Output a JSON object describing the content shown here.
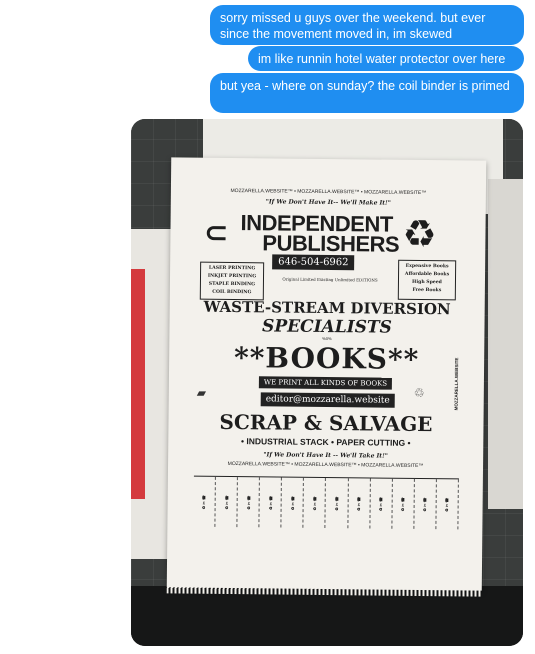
{
  "messages": [
    {
      "text": "sorry missed u guys over the weekend. but ever since the movement moved in, im skewed"
    },
    {
      "text": "im like runnin hotel water protector over here"
    },
    {
      "text": "but yea - where on sunday? the coil binder is primed"
    }
  ],
  "colors": {
    "bubble": "#1f8ef1",
    "bubble_text": "#ffffff"
  },
  "poster": {
    "top_row": "MOZZARELLA.WEBSITE™ • MOZZARELLA.WEBSITE™ • MOZZARELLA.WEBSITE™",
    "motto": "\"If We Don't Have It-- We'll Make It!\"",
    "title_line1": "INDEPENDENT",
    "title_line2": "PUBLISHERS",
    "phone": "646-504-6962",
    "left_box": [
      "LASER PRINTING",
      "INKJET PRINTING",
      "STAPLE BINDING",
      "COIL BINDING"
    ],
    "middle_small": "Original Limited  Existing Unlimited  EDITIONS",
    "right_box": [
      "Expensive Books",
      "Affordable Books",
      "High Speed",
      "Free Books"
    ],
    "waste": "WASTE-STREAM DIVERSION",
    "specialists": "SPECIALISTS",
    "percent": "%0%",
    "books": "**BOOKS**",
    "print_all": "WE PRINT ALL KINDS OF BOOKS",
    "email": "editor@mozzarella.website",
    "scrap": "SCRAP & SALVAGE",
    "industrial": "• INDUSTRIAL STACK • PAPER CUTTING •",
    "motto2": "\"If We Don't Have It -- We'll Take It!\"",
    "bottom_row": "MOZZARELLA.WEBSITE™ • MOZZARELLA.WEBSITE™ • MOZZARELLA.WEBSITE™",
    "side_text": "MOZZARELLA.WEBSITE"
  }
}
